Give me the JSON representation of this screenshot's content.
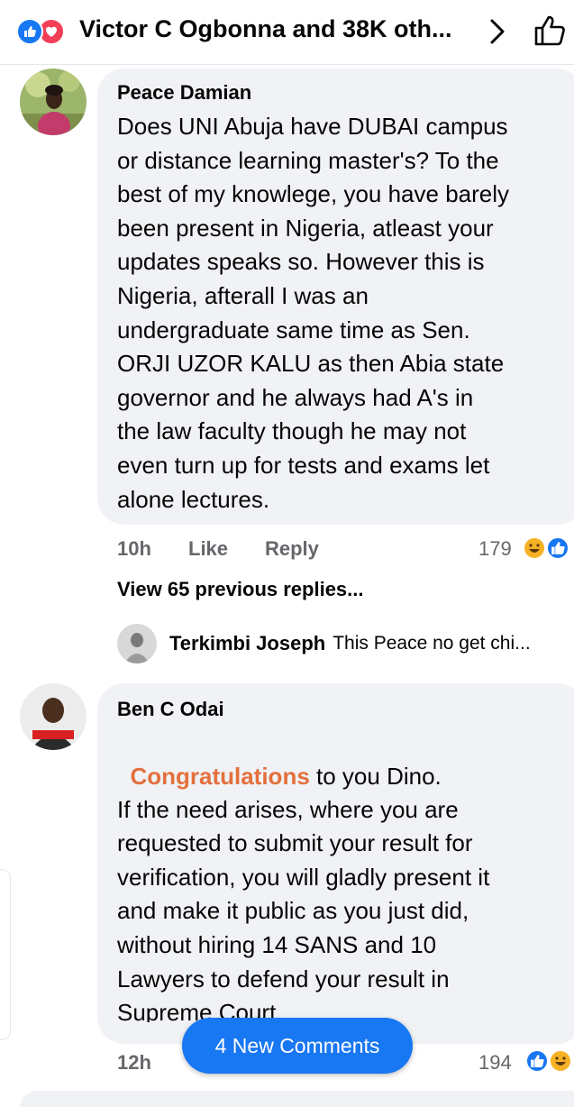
{
  "header": {
    "title": "Victor C Ogbonna and 38K oth...",
    "reaction_icons": [
      "like-icon",
      "love-icon"
    ],
    "chevron_icon": "chevron-right-icon",
    "like_icon": "thumbs-up-outline-icon"
  },
  "comments": [
    {
      "author": "Peace Damian",
      "text": "Does UNI Abuja have DUBAI campus\nor distance learning master's? To the\nbest of my knowlege, you have barely\nbeen present in Nigeria, atleast your\nupdates speaks so. However this is\nNigeria, afterall I was an\nundergraduate same time as Sen.\nORJI UZOR KALU as then Abia state\ngovernor and he always had A's in\nthe law faculty though he may not\neven turn up for tests and exams let\nalone lectures.",
      "time": "10h",
      "like_label": "Like",
      "reply_label": "Reply",
      "reaction_count": "179",
      "reactions": [
        "haha-icon",
        "like-icon"
      ]
    },
    {
      "author": "Ben C Odai",
      "highlight": "Congratulations",
      "text_after_highlight": " to you Dino.",
      "text": "\nIf the need arises, where you are\nrequested to submit your result for\nverification, you will gladly present it\nand make it public as you just did,\nwithout hiring 14 SANS and 10\nLawyers to defend your result in\nSupreme Court",
      "time": "12h",
      "reaction_count": "194",
      "reactions": [
        "like-icon",
        "haha-icon"
      ]
    }
  ],
  "replies_section": {
    "view_previous": "View 65 previous replies...",
    "reply_author": "Terkimbi Joseph",
    "reply_snippet": "This Peace no get chi..."
  },
  "new_comments_button": "4 New Comments",
  "colors": {
    "facebook_blue": "#1877f2",
    "love_red": "#f33e58",
    "highlight_orange": "#e4703d",
    "bubble_gray": "#f0f2f5",
    "secondary_text": "#65676b"
  }
}
